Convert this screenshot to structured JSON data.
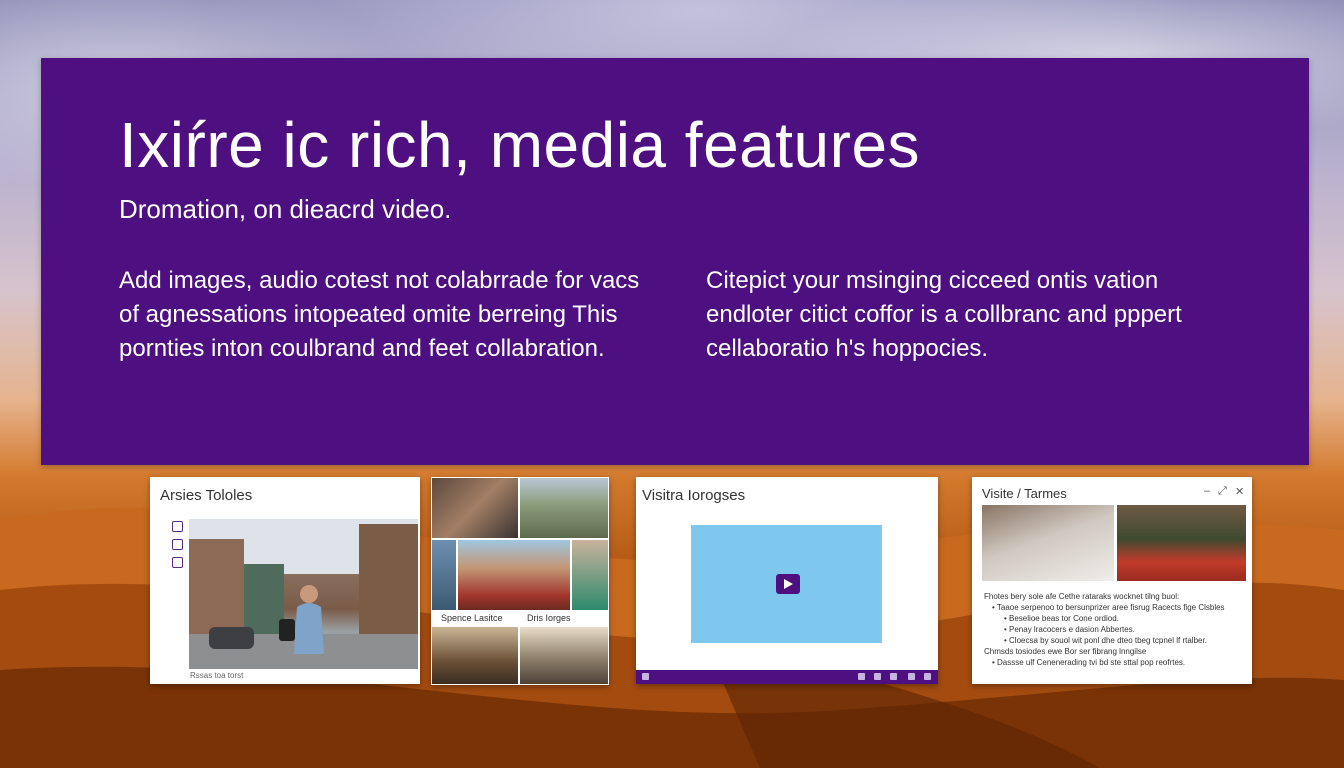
{
  "hero": {
    "title": "Ixiŕre ic rich, media  features",
    "subtitle": "Dromation, on dieacrd video.",
    "left_paragraph": [
      "Add images, audio cotest not colabrrade for vacs",
      "of agnessations intopeated omite berreing This",
      "pornties inton coulbrand and feet collabration."
    ],
    "right_paragraph": [
      "Citepict your msinging cicceed ontis vation",
      "endloter citict coffor is a collbranc and pppert",
      "cellaboratio h's hoppocies."
    ]
  },
  "thumbnails": {
    "photo_window": {
      "title": "Arsies Tololes",
      "caption": "Rssas toa torst"
    },
    "collage": {
      "label_left": "Spence Lasitce",
      "label_right": "Dris Iorges"
    },
    "video_window": {
      "title": "Visitra Iorogses"
    },
    "notes_window": {
      "title": "Visite / Tarmes",
      "minimize": "–",
      "expand": "⤢",
      "close": "✕",
      "lines": [
        "Fhotes bery sole afe Cethe rataraks wocknet tilng buol:",
        "• Taaoe serpenoo to bersunprizer aree fisrug Racects fige Clsbles",
        "• Beselioe beas tor Cone ordiod.",
        "• Penay lracocers e dasion Abbertes.",
        "• Cloecsa by souol wit ponl dhe dteo tbeg tcpnel lf rtalber.",
        "Chmsds tosiodes ewe Bor ser fibrang lnngilse",
        "• Dassse ulf Cenenerading tvi bd ste sttal pop reofrtes."
      ]
    }
  }
}
